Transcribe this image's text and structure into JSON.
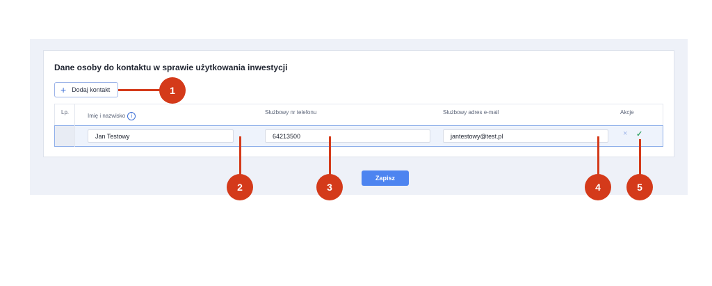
{
  "section": {
    "title": "Dane osoby do kontaktu w sprawie użytkowania inwestycji"
  },
  "toolbar": {
    "add_label": "Dodaj kontakt",
    "add_icon": "plus-icon"
  },
  "table": {
    "columns": {
      "lp": "Lp.",
      "name": "Imię i nazwisko",
      "phone": "Służbowy nr telefonu",
      "email": "Służbowy adres e-mail",
      "actions": "Akcje"
    },
    "rows": [
      {
        "lp": "",
        "name": "Jan Testowy",
        "phone": "64213500",
        "email": "jantestowy@test.pl"
      }
    ],
    "action_icons": {
      "cancel": "×",
      "confirm": "✓"
    }
  },
  "footer": {
    "save_label": "Zapisz"
  },
  "callouts": [
    "1",
    "2",
    "3",
    "4",
    "5"
  ],
  "colors": {
    "accent": "#4d84f0",
    "callout": "#d43a1a",
    "confirm": "#3aa56a"
  }
}
